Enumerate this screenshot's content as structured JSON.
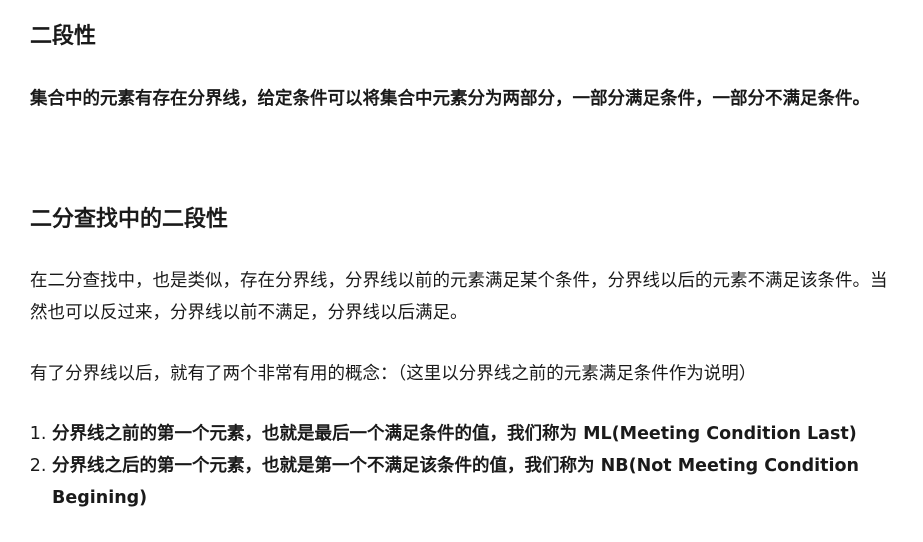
{
  "sections": [
    {
      "heading": "二段性",
      "paragraph": "集合中的元素有存在分界线，给定条件可以将集合中元素分为两部分，一部分满足条件，一部分不满足条件。"
    },
    {
      "heading": "二分查找中的二段性",
      "paragraph1": "在二分查找中，也是类似，存在分界线，分界线以前的元素满足某个条件，分界线以后的元素不满足该条件。当然也可以反过来，分界线以前不满足，分界线以后满足。",
      "paragraph2": "有了分界线以后，就有了两个非常有用的概念：（这里以分界线之前的元素满足条件作为说明）",
      "list": [
        "分界线之前的第一个元素，也就是最后一个满足条件的值，我们称为 ML(Meeting Condition Last)",
        "分界线之后的第一个元素，也就是第一个不满足该条件的值，我们称为 NB(Not Meeting Condition Begining)"
      ]
    }
  ]
}
